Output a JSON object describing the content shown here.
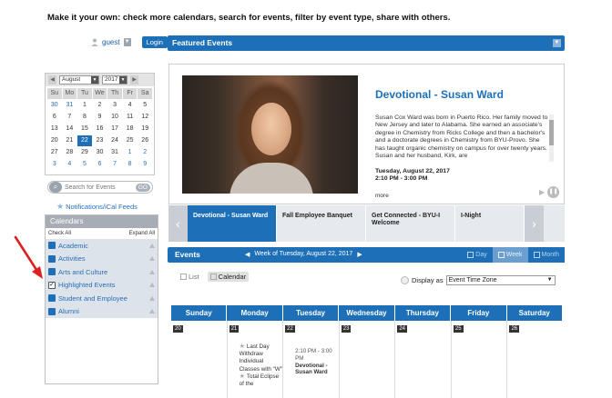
{
  "header": {
    "tagline": "Make it your own:  check more calendars, search for events, filter by event type, share with others."
  },
  "user": {
    "name": "guest",
    "login_label": "Login"
  },
  "mini_calendar": {
    "month": "August",
    "year": "2017",
    "weekdays": [
      "Su",
      "Mo",
      "Tu",
      "We",
      "Th",
      "Fr",
      "Sa"
    ],
    "weeks": [
      [
        "30",
        "31",
        "1",
        "2",
        "3",
        "4",
        "5"
      ],
      [
        "6",
        "7",
        "8",
        "9",
        "10",
        "11",
        "12"
      ],
      [
        "13",
        "14",
        "15",
        "16",
        "17",
        "18",
        "19"
      ],
      [
        "20",
        "21",
        "22",
        "23",
        "24",
        "25",
        "26"
      ],
      [
        "27",
        "28",
        "29",
        "30",
        "31",
        "1",
        "2"
      ],
      [
        "3",
        "4",
        "5",
        "6",
        "7",
        "8",
        "9"
      ]
    ],
    "today": "22"
  },
  "search": {
    "placeholder": "Search for Events",
    "go_label": "GO"
  },
  "notifications": {
    "label": "Notifications/iCal Feeds"
  },
  "calendars": {
    "title": "Calendars",
    "check_all": "Check All",
    "expand_all": "Expand All",
    "items": [
      {
        "label": "Academic",
        "checked": false
      },
      {
        "label": "Activities",
        "checked": false
      },
      {
        "label": "Arts and Culture",
        "checked": false
      },
      {
        "label": "Highlighted Events",
        "checked": true
      },
      {
        "label": "Student and Employee",
        "checked": false
      },
      {
        "label": "Alumni",
        "checked": false
      }
    ]
  },
  "featured": {
    "title": "Featured Events",
    "event_title": "Devotional - Susan Ward",
    "description": "Susan Cox Ward was born in Puerto Rico. Her family moved to New Jersey and later to Alabama. She earned an associate's degree in Chemistry from Ricks College and then a bachelor's and a doctorate degrees in Chemistry from BYU-Provo. She has taught organic chemistry on campus for over twenty years. Susan and her husband, Kirk, are",
    "date": "Tuesday, August 22, 2017",
    "time": "2:10 PM - 3:00 PM",
    "more": "more",
    "carousel": [
      "Devotional - Susan Ward",
      "Fall Employee Banquet",
      "Get Connected - BYU-I Welcome",
      "I-Night"
    ]
  },
  "events": {
    "title": "Events",
    "week_label": "Week of Tuesday, August 22, 2017",
    "views": [
      "Day",
      "Week",
      "Month"
    ],
    "active_view": "Week",
    "list_label": "List",
    "calendar_label": "Calendar",
    "display_as_label": "Display as",
    "display_as_value": "Event Time Zone",
    "weekdays": [
      "Sunday",
      "Monday",
      "Tuesday",
      "Wednesday",
      "Thursday",
      "Friday",
      "Saturday"
    ],
    "dates": [
      "20",
      "21",
      "22",
      "23",
      "24",
      "25",
      "26"
    ],
    "monday_events": [
      "Last Day Withdraw Individual Classes with \"W\"",
      "Total Eclipse of the"
    ],
    "tuesday_event": {
      "time": "2:10 PM - 3:00 PM",
      "name": "Devotional - Susan Ward"
    }
  },
  "colors": {
    "primary_blue": "#1d70b8",
    "annotation_red": "#e02020"
  }
}
